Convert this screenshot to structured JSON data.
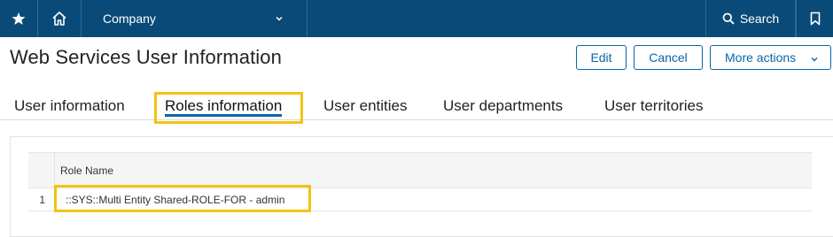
{
  "topbar": {
    "favorites_icon": "star-icon",
    "home_icon": "home-icon",
    "company_label": "Company",
    "company_chevron_icon": "chevron-down-icon",
    "search_icon": "search-icon",
    "search_label": "Search",
    "bookmark_icon": "bookmark-icon"
  },
  "header": {
    "title": "Web Services User Information",
    "edit_label": "Edit",
    "cancel_label": "Cancel",
    "more_actions_label": "More actions"
  },
  "tabs": [
    {
      "label": "User information",
      "active": false
    },
    {
      "label": "Roles information",
      "active": true
    },
    {
      "label": "User entities",
      "active": false
    },
    {
      "label": "User departments",
      "active": false
    },
    {
      "label": "User territories",
      "active": false
    }
  ],
  "roles_grid": {
    "columns": [
      "Role Name"
    ],
    "rows": [
      {
        "index": "1",
        "role_name": "::SYS::Multi Entity Shared-ROLE-FOR - admin"
      }
    ]
  },
  "colors": {
    "topbar_bg": "#0a4a78",
    "accent": "#0a65a8",
    "highlight": "#f2c312"
  }
}
